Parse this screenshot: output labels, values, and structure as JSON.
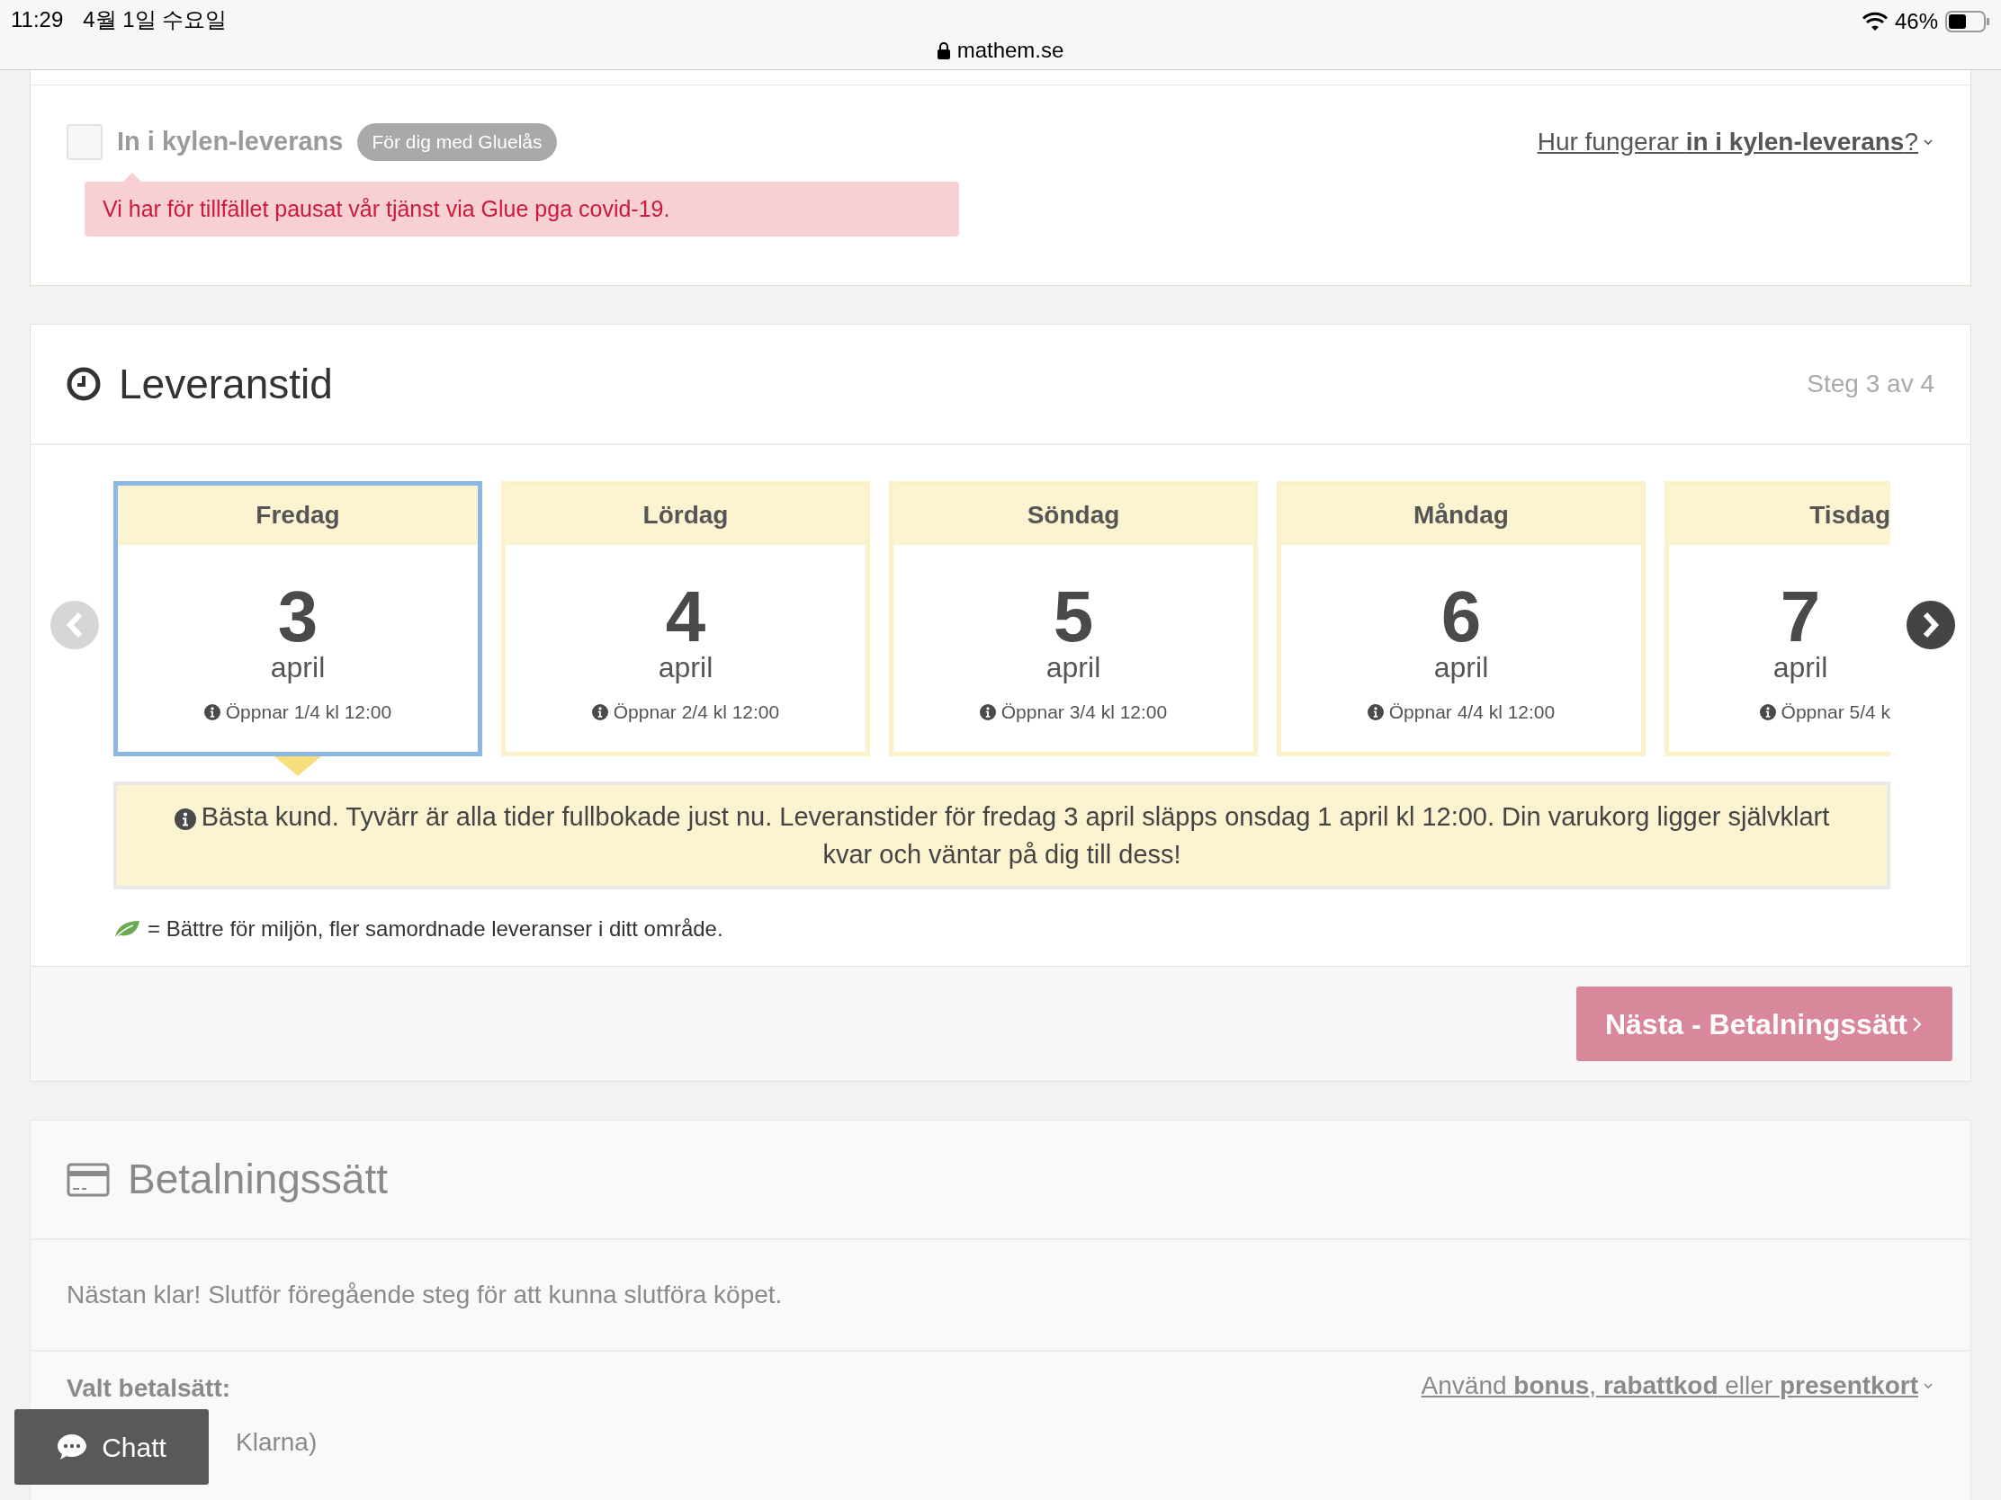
{
  "status_bar": {
    "time": "11:29",
    "date": "4월 1일 수요일",
    "url": "mathem.se",
    "battery": "46%"
  },
  "fridge_delivery": {
    "checked": false,
    "label": "In i kylen-leverans",
    "tag": "För dig med Gluelås",
    "alert": "Vi har för tillfället pausat vår tjänst via Glue pga covid-19.",
    "help_link": "Hur fungerar **in i kylen-leverans**?"
  },
  "delivery_time": {
    "title": "Leveranstid",
    "step": "Steg 3 av 4",
    "days": [
      {
        "weekday": "Fredag",
        "day": "3",
        "month": "april",
        "opens": "Öppnar 1/4 kl 12:00",
        "selected": true
      },
      {
        "weekday": "Lördag",
        "day": "4",
        "month": "april",
        "opens": "Öppnar 2/4 kl 12:00",
        "selected": false
      },
      {
        "weekday": "Söndag",
        "day": "5",
        "month": "april",
        "opens": "Öppnar 3/4 kl 12:00",
        "selected": false
      },
      {
        "weekday": "Måndag",
        "day": "6",
        "month": "april",
        "opens": "Öppnar 4/4 kl 12:00",
        "selected": false
      },
      {
        "weekday": "Tisdag",
        "day": "7",
        "month": "april",
        "opens": "Öppnar 5/4 k",
        "selected": false
      }
    ],
    "notice": "Bästa kund. Tyvärr är alla tider fullbokade just nu. Leveranstider för fredag 3 april släpps onsdag 1 april kl 12:00. Din varukorg ligger självklart kvar och väntar på dig till dess!",
    "legend": "= Bättre för miljön, fler samordnade leveranser i ditt område.",
    "next_button": "Nästa - Betalningssätt"
  },
  "payment": {
    "title": "Betalningssätt",
    "message": "Nästan klar! Slutför föregående steg för att kunna slutföra köpet.",
    "selected_label": "Valt betalsätt:",
    "selected_value": "Klarna)",
    "discount_link": "Använd **bonus**, **rabattkod** eller **presentkort**"
  },
  "chat_button": "Chatt"
}
